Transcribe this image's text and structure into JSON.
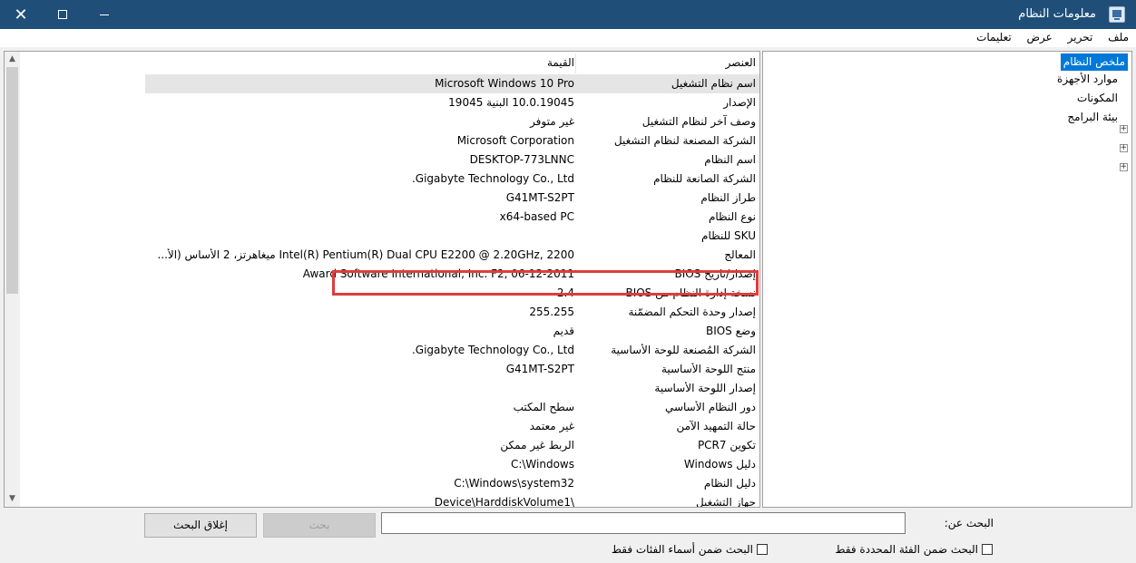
{
  "window": {
    "title": "معلومات النظام"
  },
  "menu": [
    "ملف",
    "تحرير",
    "عرض",
    "تعليمات"
  ],
  "tree": [
    {
      "label": "ملخص النظام",
      "selected": true,
      "expandable": false
    },
    {
      "label": "موارد الأجهزة",
      "selected": false,
      "expandable": true
    },
    {
      "label": "المكونات",
      "selected": false,
      "expandable": true
    },
    {
      "label": "بيئة البرامج",
      "selected": false,
      "expandable": true
    }
  ],
  "list": {
    "header": {
      "item": "العنصر",
      "value": "القيمة"
    },
    "rows": [
      {
        "item": "اسم نظام التشغيل",
        "value": "Microsoft Windows 10 Pro",
        "highlight": true
      },
      {
        "item": "الإصدار",
        "value": "10.0.19045 البنية 19045"
      },
      {
        "item": "وصف آخر لنظام التشغيل",
        "value": "غير متوفر"
      },
      {
        "item": "الشركة المصنعة لنظام التشغيل",
        "value": "Microsoft Corporation"
      },
      {
        "item": "اسم النظام",
        "value": "DESKTOP-773LNNC"
      },
      {
        "item": "الشركة الصانعة للنظام",
        "value": "Gigabyte Technology Co., Ltd."
      },
      {
        "item": "طراز النظام",
        "value": "G41MT-S2PT"
      },
      {
        "item": "نوع النظام",
        "value": "x64-based PC"
      },
      {
        "item": "SKU للنظام",
        "value": ""
      },
      {
        "item": "المعالج",
        "value": "Intel(R) Pentium(R) Dual  CPU  E2200  @ 2.20GHz, 2200 ميغاهرتز، 2 الأساس (الأ..."
      },
      {
        "item": "إصدار/تاريخ BIOS",
        "value": "Award Software International, Inc. F2, 06-12-2011"
      },
      {
        "item": "نسخة إدارة النظام من BIOS",
        "value": "2.4"
      },
      {
        "item": "إصدار وحدة التحكم المضمّنة",
        "value": "255.255"
      },
      {
        "item": "وضع BIOS",
        "value": "قديم"
      },
      {
        "item": "الشركة المُصنعة للوحة الأساسية",
        "value": "Gigabyte Technology Co., Ltd."
      },
      {
        "item": "منتج اللوحة الأساسية",
        "value": "G41MT-S2PT"
      },
      {
        "item": "إصدار اللوحة الأساسية",
        "value": ""
      },
      {
        "item": "دور النظام الأساسي",
        "value": "سطح المكتب"
      },
      {
        "item": "حالة التمهيد الآمن",
        "value": "غير معتمد"
      },
      {
        "item": "تكوين PCR7",
        "value": "الربط غير ممكن"
      },
      {
        "item": "دليل Windows",
        "value": "C:\\Windows"
      },
      {
        "item": "دليل النظام",
        "value": "C:\\Windows\\system32"
      },
      {
        "item": "جهاز التشغيل",
        "value": "\\Device\\HarddiskVolume1"
      }
    ]
  },
  "search": {
    "label": "البحث عن:",
    "value": "",
    "find_button": "بحث",
    "close_button": "إغلاق البحث",
    "option_selected_category": "البحث ضمن الفئة المحددة فقط",
    "option_category_names": "البحث ضمن أسماء الفئات فقط"
  },
  "colors": {
    "titlebar": "#1f4e79",
    "selection": "#0078d7",
    "annotation_box": "#e03c3c"
  }
}
